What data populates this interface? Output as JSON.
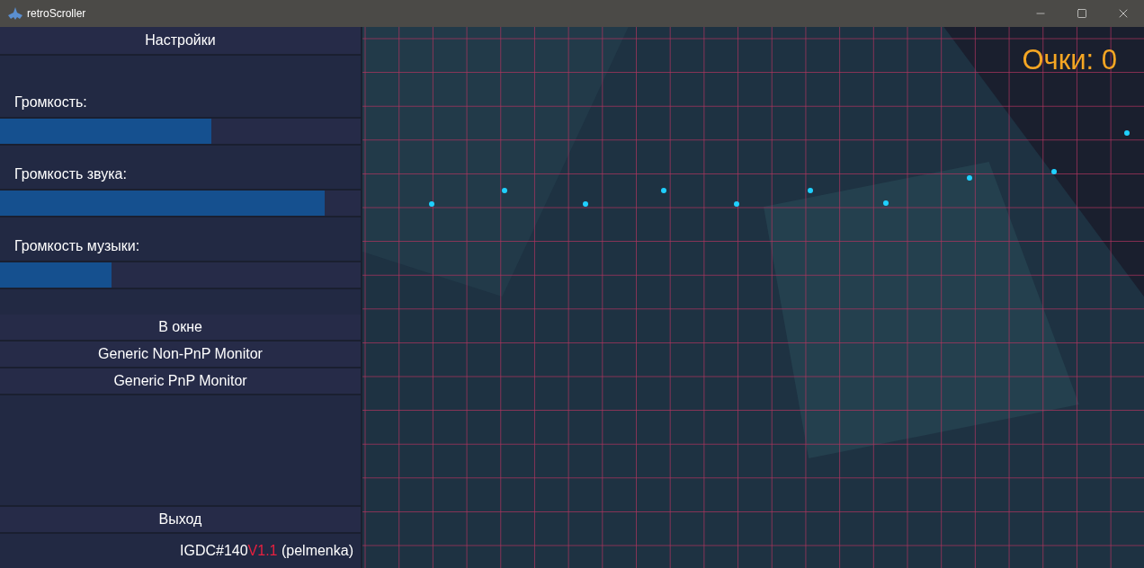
{
  "window": {
    "title": "retroScroller"
  },
  "settings": {
    "title": "Настройки",
    "sliders": [
      {
        "label": "Громкость:",
        "level": 0.585
      },
      {
        "label": "Громкость звука:",
        "level": 0.9
      },
      {
        "label": "Громкость музыки:",
        "level": 0.31
      }
    ],
    "buttons": [
      "В окне",
      "Generic Non-PnP Monitor",
      "Generic PnP Monitor"
    ],
    "exit": "Выход",
    "footer": {
      "prefix": "IGDC#140",
      "version": "V1.1",
      "suffix": " (pelmenka)"
    }
  },
  "game": {
    "score": "Очки: 0"
  }
}
